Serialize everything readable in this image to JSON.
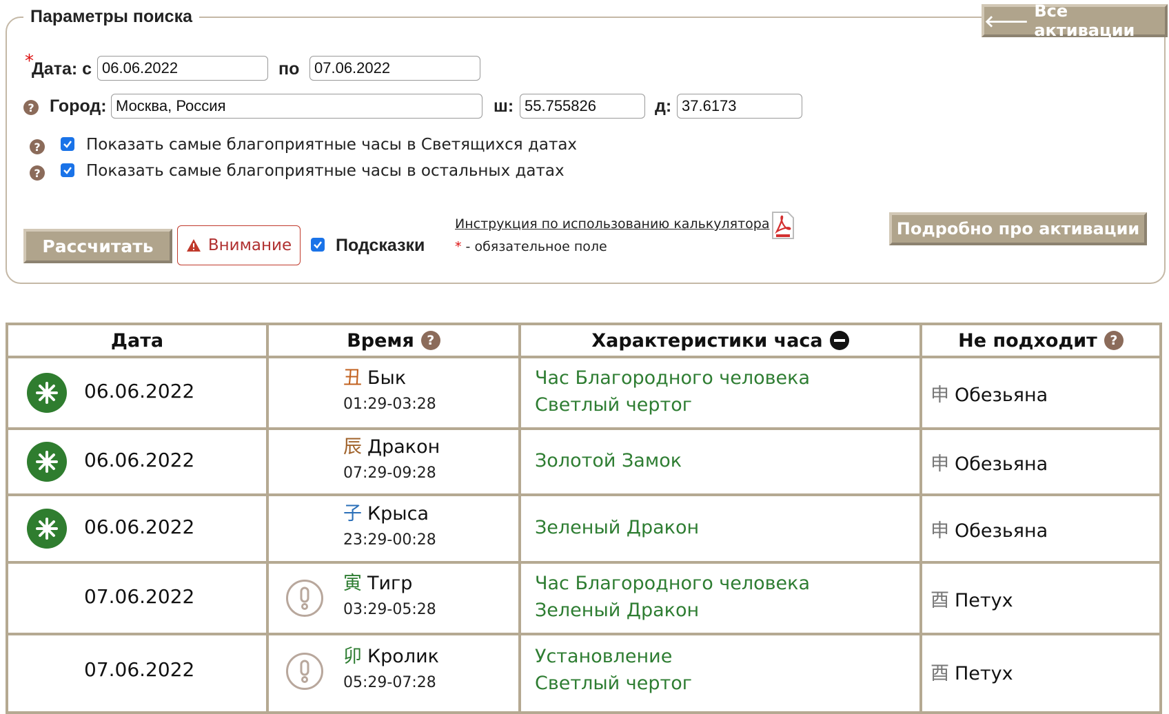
{
  "params": {
    "legend": "Параметры поиска",
    "all_activations": "Все активации",
    "date_from_label": "Дата: с",
    "date_from": "06.06.2022",
    "date_to_label": "по",
    "date_to": "07.06.2022",
    "city_label": "Город:",
    "city": "Москва, Россия",
    "lat_label": "ш:",
    "lat": "55.755826",
    "lon_label": "д:",
    "lon": "37.6173",
    "cb_shining": "Показать самые благоприятные часы в Светящихся датах",
    "cb_other": "Показать самые благоприятные часы в остальных датах",
    "calculate": "Рассчитать",
    "attention": "Внимание",
    "hints": "Подсказки",
    "instruction_link": "Инструкция по использованию калькулятора",
    "required_note": "- обязательное поле",
    "details": "Подробно про активации",
    "colors": {
      "accent_btn": "#b0a48c",
      "check": "#1a73e8",
      "green": "#2e7d32",
      "warn": "#b03030"
    }
  },
  "table": {
    "headers": {
      "date": "Дата",
      "time": "Время",
      "characteristics": "Характеристики часа",
      "not_suitable": "Не подходит"
    },
    "rows": [
      {
        "date": "06.06.2022",
        "shining": true,
        "alert": false,
        "hz": "丑",
        "hz_color": "#c2611f",
        "animal": "Бык",
        "range": "01:29-03:28",
        "chars": [
          "Час Благородного человека",
          "Светлый чертог"
        ],
        "ns_hz": "申",
        "ns": "Обезьяна"
      },
      {
        "date": "06.06.2022",
        "shining": true,
        "alert": false,
        "hz": "辰",
        "hz_color": "#a0622a",
        "animal": "Дракон",
        "range": "07:29-09:28",
        "chars": [
          "Золотой Замок"
        ],
        "ns_hz": "申",
        "ns": "Обезьяна"
      },
      {
        "date": "06.06.2022",
        "shining": true,
        "alert": false,
        "hz": "子",
        "hz_color": "#2a6fb8",
        "animal": "Крыса",
        "range": "23:29-00:28",
        "chars": [
          "Зеленый Дракон"
        ],
        "ns_hz": "申",
        "ns": "Обезьяна"
      },
      {
        "date": "07.06.2022",
        "shining": false,
        "alert": true,
        "hz": "寅",
        "hz_color": "#2e7d32",
        "animal": "Тигр",
        "range": "03:29-05:28",
        "chars": [
          "Час Благородного человека",
          "Зеленый Дракон"
        ],
        "ns_hz": "酉",
        "ns": "Петух"
      },
      {
        "date": "07.06.2022",
        "shining": false,
        "alert": true,
        "hz": "卯",
        "hz_color": "#2e7d32",
        "animal": "Кролик",
        "range": "05:29-07:28",
        "chars": [
          "Установление",
          "Светлый чертог"
        ],
        "ns_hz": "酉",
        "ns": "Петух"
      }
    ]
  }
}
